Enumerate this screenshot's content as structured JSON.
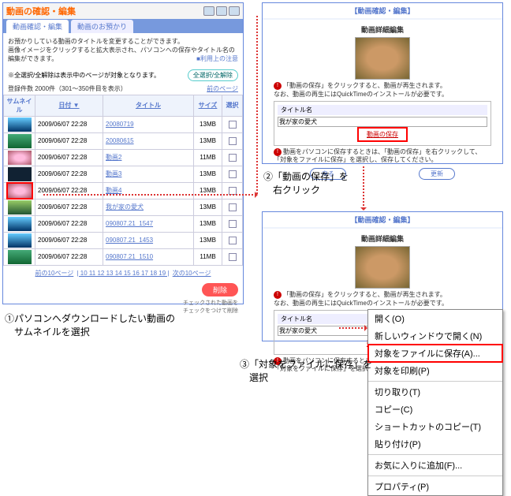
{
  "left": {
    "title": "動画の確認・編集",
    "tab1": "動画確認・編集",
    "tab2": "動画のお預かり",
    "desc": "お預かりしている動画のタイトルを変更することができます。\n画像イメージをクリックすると拡大表示され、パソコンへの保存やタイトル名の編集ができます。",
    "caution": "■利用上の注意",
    "count_note": "※全選択/全解除は表示中のページが対象となります。",
    "expand_btn": "全選択/全解除",
    "count": "登録件数 2000件（301～350件目を表示）",
    "page_link": "前のページ",
    "cols": {
      "thumb": "サムネイル",
      "date": "日付 ▼",
      "title": "タイトル",
      "size": "サイズ",
      "sel": "選択"
    },
    "rows": [
      {
        "date": "2009/06/07 22:28",
        "title": "20080719",
        "size": "13MB",
        "thumb": "blue"
      },
      {
        "date": "2009/06/07 22:28",
        "title": "20080615",
        "size": "13MB",
        "thumb": "nature"
      },
      {
        "date": "2009/06/07 22:28",
        "title": "動画2",
        "size": "11MB",
        "thumb": "flowers"
      },
      {
        "date": "2009/06/07 22:28",
        "title": "動画3",
        "size": "13MB",
        "thumb": "dark"
      },
      {
        "date": "2009/06/07 22:28",
        "title": "動画4",
        "size": "13MB",
        "thumb": "flowers",
        "selected": true
      },
      {
        "date": "2009/06/07 22:28",
        "title": "我が家の愛犬",
        "size": "13MB",
        "thumb": "grass"
      },
      {
        "date": "2009/06/07 22:28",
        "title": "090807.21_1547",
        "size": "13MB",
        "thumb": "blue"
      },
      {
        "date": "2009/06/07 22:28",
        "title": "090807.21_1453",
        "size": "13MB",
        "thumb": "blue"
      },
      {
        "date": "2009/06/07 22:28",
        "title": "090807.21_1510",
        "size": "11MB",
        "thumb": "nature"
      }
    ],
    "pager_prev": "前の10ページ",
    "pager_pages": "| 10 11 12 13 14 15 16 17 18 19 |",
    "pager_next": "次の10ページ",
    "delete_btn": "削除",
    "delete_note": "チェックされた動画を\nチェックをつけて削除"
  },
  "right": {
    "crumb": "【動画確認・編集】",
    "section_title": "動画詳細編集",
    "line1": "「動画の保存」をクリックすると、動画が再生されます。\nなお、動画の再生にはQuickTimeのインストールが必要です。",
    "title_label": "タイトル名",
    "title_value": "我が家の愛犬",
    "save_link": "動画の保存",
    "line2": "動画をパソコンに保存するときは、「動画の保存」を右クリックして、\n「対象をファイルに保存」を選択し、保存してください。",
    "btn_back": "戻る",
    "btn_update": "更新"
  },
  "ctx": {
    "items": [
      "開く(O)",
      "新しいウィンドウで開く(N)",
      "対象をファイルに保存(A)...",
      "対象を印刷(P)",
      "-",
      "切り取り(T)",
      "コピー(C)",
      "ショートカットのコピー(T)",
      "貼り付け(P)",
      "-",
      "お気に入りに追加(F)...",
      "-",
      "プロパティ(P)"
    ],
    "selected_index": 2
  },
  "anno": {
    "a1": "①パソコンへダウンロードしたい動画の\n　サムネイルを選択",
    "a2": "②「動画の保存」を\n　右クリック",
    "a3": "③「対象をファイルに保存」を\n　選択"
  }
}
